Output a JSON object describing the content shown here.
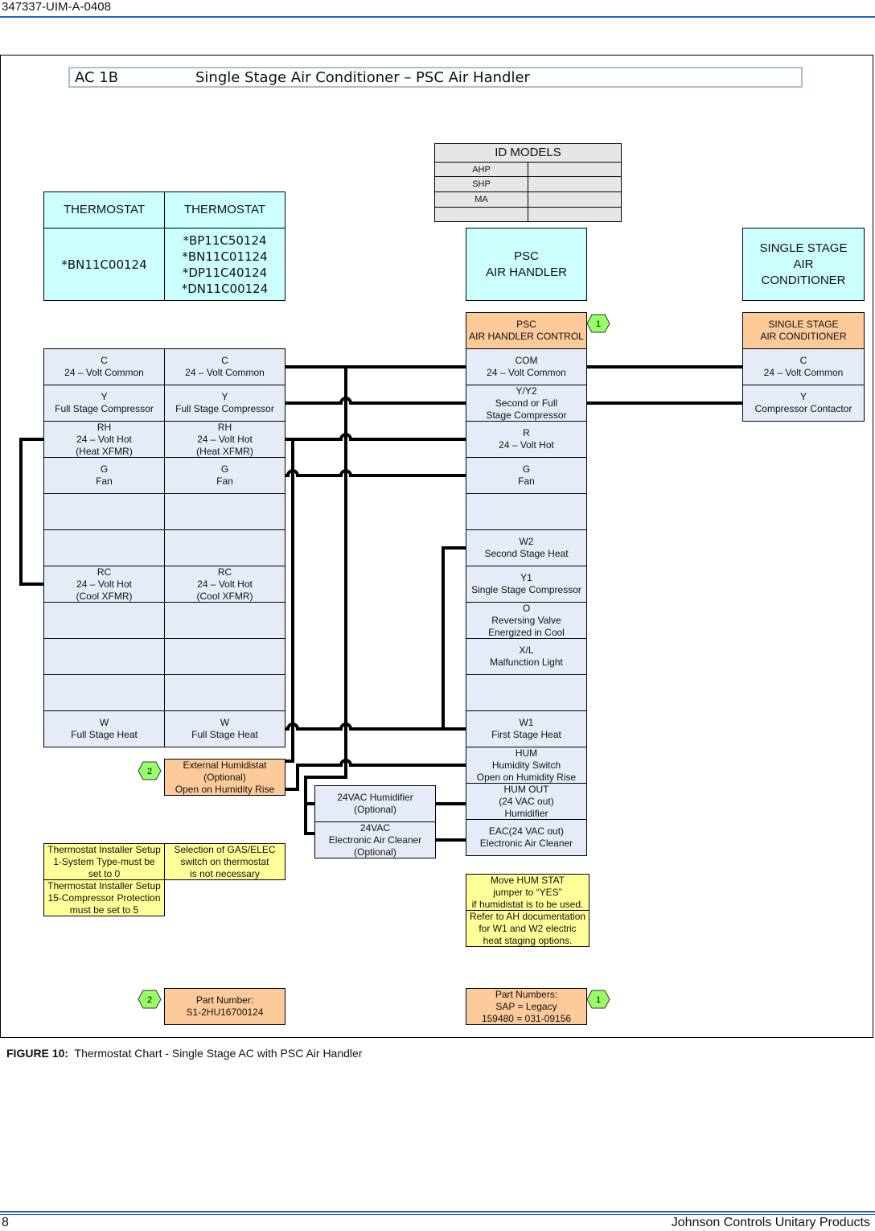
{
  "header": {
    "doc_id": "347337-UIM-A-0408"
  },
  "title": {
    "code": "AC 1B",
    "description": "Single Stage Air Conditioner – PSC Air Handler"
  },
  "id_models": {
    "title": "ID MODELS",
    "rows": [
      [
        "AHP",
        ""
      ],
      [
        "SHP",
        ""
      ],
      [
        "MA",
        ""
      ],
      [
        "",
        ""
      ]
    ]
  },
  "thermostats": [
    {
      "header": "THERMOSTAT",
      "models": "*BN11C00124"
    },
    {
      "header": "THERMOSTAT",
      "models": "*BP11C50124\n*BN11C01124\n*DP11C40124\n*DN11C00124"
    }
  ],
  "air_handler": {
    "label": "PSC\nAIR HANDLER",
    "control_label": "PSC\nAIR HANDLER CONTROL",
    "badge": "1"
  },
  "outdoor_unit": {
    "label": "SINGLE STAGE\nAIR\nCONDITIONER",
    "control_label": "SINGLE STAGE\nAIR CONDITIONER"
  },
  "thermostat_terminals": [
    "C\n24 – Volt Common",
    "Y\nFull Stage Compressor",
    "RH\n24 – Volt Hot\n(Heat XFMR)",
    "G\nFan",
    "",
    "",
    "RC\n24 – Volt Hot\n(Cool XFMR)",
    "",
    "",
    "",
    "W\nFull Stage Heat"
  ],
  "air_handler_terminals": [
    "COM\n24 – Volt Common",
    "Y/Y2\nSecond or Full\nStage Compressor",
    "R\n24 – Volt Hot",
    "G\nFan",
    "",
    "W2\nSecond Stage Heat",
    "Y1\nSingle Stage Compressor",
    "O\nReversing Valve\nEnergized in Cool",
    "X/L\nMalfunction Light",
    "",
    "W1\nFirst Stage Heat",
    "HUM\nHumidity Switch\nOpen on Humidity Rise",
    "HUM OUT\n(24 VAC out)\nHumidifier",
    "EAC(24 VAC out)\nElectronic Air Cleaner"
  ],
  "outdoor_terminals": [
    "C\n24 – Volt Common",
    "Y\nCompressor Contactor"
  ],
  "humidistat": {
    "label": "External Humidistat\n(Optional)\nOpen on Humidity Rise",
    "badge": "2"
  },
  "accessories": [
    "24VAC Humidifier\n(Optional)",
    "24VAC\nElectronic Air Cleaner\n(Optional)"
  ],
  "notes": {
    "installer_setup_1": "Thermostat Installer Setup\n1-System Type-must be\nset to 0",
    "gas_elec": "Selection of GAS/ELEC\nswitch on thermostat\nis not necessary",
    "installer_setup_15": "Thermostat Installer Setup\n15-Compressor Protection\nmust be set to 5",
    "hum_stat": "Move HUM STAT\njumper to “YES”\nif humidistat is to be used.",
    "ah_doc": "Refer to AH documentation\nfor W1 and W2 electric\nheat staging options."
  },
  "part_numbers": {
    "humidistat": {
      "badge": "2",
      "label": "Part Number:\nS1-2HU16700124"
    },
    "control": {
      "badge": "1",
      "label": "Part Numbers:\nSAP   =    Legacy\n159480  =  031-09156"
    }
  },
  "caption": {
    "figure": "FIGURE 10:",
    "text": "Thermostat Chart - Single Stage AC with PSC Air Handler"
  },
  "footer": {
    "page": "8",
    "company": "Johnson Controls Unitary Products"
  },
  "colors": {
    "header_rule": "#1e5fd6",
    "cyan": "#ccffff",
    "terminal": "#e6ecf7",
    "orange": "#fdca99",
    "note": "#ffff99",
    "badge": "#99ff66"
  }
}
